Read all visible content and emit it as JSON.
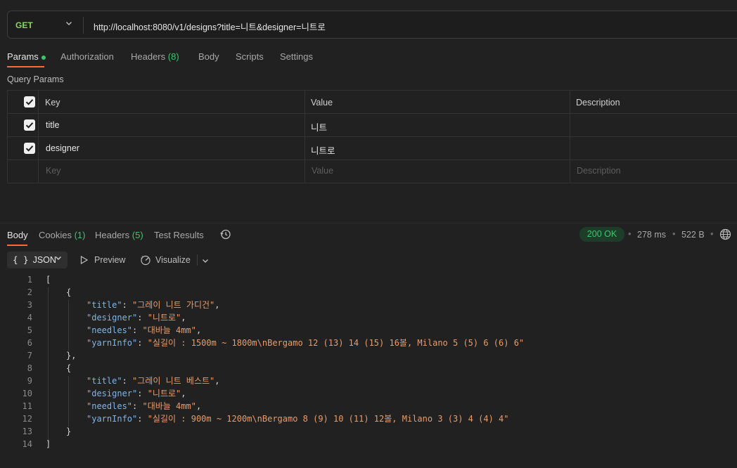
{
  "request": {
    "method": "GET",
    "url": "http://localhost:8080/v1/designs?title=니트&designer=니트로"
  },
  "request_tabs": [
    {
      "label": "Params",
      "active": true
    },
    {
      "label": "Authorization"
    },
    {
      "label": "Headers",
      "count": "(8)"
    },
    {
      "label": "Body"
    },
    {
      "label": "Scripts"
    },
    {
      "label": "Settings"
    }
  ],
  "query_params": {
    "title": "Query Params",
    "headers": {
      "key": "Key",
      "value": "Value",
      "description": "Description"
    },
    "rows": [
      {
        "checked": true,
        "key": "title",
        "value": "니트",
        "description": ""
      },
      {
        "checked": true,
        "key": "designer",
        "value": "니트로",
        "description": ""
      }
    ],
    "placeholder": {
      "key": "Key",
      "value": "Value",
      "description": "Description"
    }
  },
  "response_tabs": [
    {
      "label": "Body",
      "active": true
    },
    {
      "label": "Cookies",
      "count": "(1)"
    },
    {
      "label": "Headers",
      "count": "(5)"
    },
    {
      "label": "Test Results"
    }
  ],
  "response_meta": {
    "status": "200 OK",
    "time": "278 ms",
    "size": "522 B",
    "sep": "•"
  },
  "body_toolbar": {
    "format": "JSON",
    "format_icon": "{ }",
    "preview": "Preview",
    "visualize": "Visualize"
  },
  "response_body": {
    "line_numbers": [
      "1",
      "2",
      "3",
      "4",
      "5",
      "6",
      "7",
      "8",
      "9",
      "10",
      "11",
      "12",
      "13",
      "14"
    ],
    "open_bracket": "[",
    "close_bracket": "]",
    "open_brace": "{",
    "close_brace_comma": "},",
    "close_brace": "}",
    "items": [
      {
        "title": "\"그레이 니트 가디건\"",
        "designer": "\"니트로\"",
        "needles": "\"대바늘 4mm\"",
        "yarnInfo": "\"실길이 : 1500m ~ 1800m\\nBergamo 12 (13) 14 (15) 16볼, Milano 5 (5) 6 (6) 6\""
      },
      {
        "title": "\"그레이 니트 베스트\"",
        "designer": "\"니트로\"",
        "needles": "\"대바늘 4mm\"",
        "yarnInfo": "\"실길이 : 900m ~ 1200m\\nBergamo 8 (9) 10 (11) 12볼, Milano 3 (3) 4 (4) 4\""
      }
    ],
    "keys": {
      "title": "\"title\"",
      "designer": "\"designer\"",
      "needles": "\"needles\"",
      "yarnInfo": "\"yarnInfo\""
    }
  }
}
